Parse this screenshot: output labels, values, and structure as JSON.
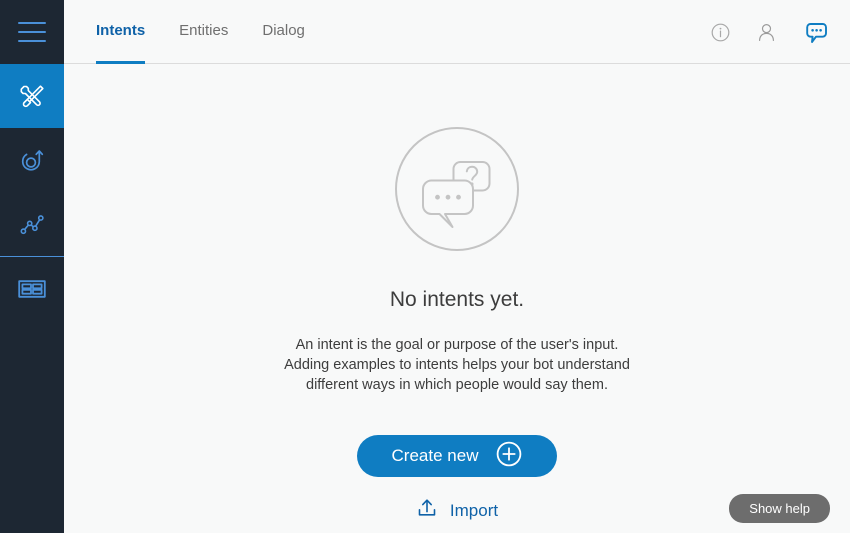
{
  "sidebar": {
    "toggle": {
      "icon": "hamburger-menu-icon"
    },
    "items": [
      {
        "id": "build",
        "icon": "tools-icon",
        "active": true
      },
      {
        "id": "improve",
        "icon": "target-arrow-icon",
        "active": false
      },
      {
        "id": "analytics",
        "icon": "line-chart-icon",
        "active": false
      },
      {
        "id": "content",
        "icon": "table-grid-icon",
        "active": false
      }
    ]
  },
  "header": {
    "tabs": [
      {
        "label": "Intents",
        "active": true
      },
      {
        "label": "Entities",
        "active": false
      },
      {
        "label": "Dialog",
        "active": false
      }
    ],
    "actions": [
      {
        "id": "info",
        "icon": "info-icon"
      },
      {
        "id": "account",
        "icon": "user-icon"
      },
      {
        "id": "chat",
        "icon": "chat-bubble-icon"
      }
    ]
  },
  "main": {
    "illustration": "speech-bubbles-question-icon",
    "title": "No intents yet.",
    "description_lines": [
      "An intent is the goal or purpose of the user's input.",
      "Adding examples to intents helps your bot understand",
      "different ways in which people would say them."
    ],
    "create_label": "Create new",
    "import_label": "Import"
  },
  "footer": {
    "show_help_label": "Show help"
  },
  "colors": {
    "sidebar_bg": "#1d2733",
    "accent_blue": "#0f7dc2",
    "link_blue": "#0f62a8",
    "page_bg": "#f8f9f9",
    "help_grey": "#6d6d6d"
  }
}
